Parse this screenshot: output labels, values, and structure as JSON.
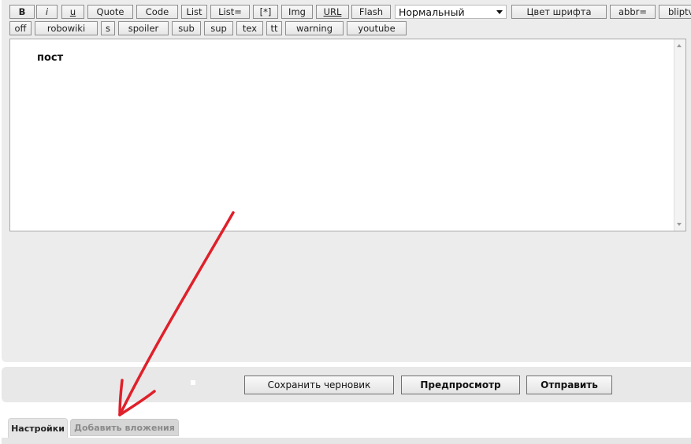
{
  "toolbar": {
    "row1": [
      {
        "label": "B"
      },
      {
        "label": "i"
      },
      {
        "label": "u"
      },
      {
        "label": "Quote"
      },
      {
        "label": "Code"
      },
      {
        "label": "List"
      },
      {
        "label": "List="
      },
      {
        "label": "[*]"
      },
      {
        "label": "Img"
      },
      {
        "label": "URL"
      },
      {
        "label": "Flash"
      }
    ],
    "font_size_select": "Нормальный",
    "row1_after": [
      {
        "label": "Цвет шрифта"
      },
      {
        "label": "abbr="
      },
      {
        "label": "bliptv"
      }
    ],
    "row2": [
      {
        "label": "off"
      },
      {
        "label": "robowiki"
      },
      {
        "label": "s"
      },
      {
        "label": "spoiler"
      },
      {
        "label": "sub"
      },
      {
        "label": "sup"
      },
      {
        "label": "tex"
      },
      {
        "label": "tt"
      },
      {
        "label": "warning"
      },
      {
        "label": "youtube"
      }
    ]
  },
  "editor": {
    "content": "пост"
  },
  "actions": {
    "save_draft": "Сохранить черновик",
    "preview": "Предпросмотр",
    "submit": "Отправить"
  },
  "tabs": [
    {
      "label": "Настройки",
      "active": true
    },
    {
      "label": "Добавить вложения",
      "active": false
    }
  ],
  "colors": {
    "panel": "#ececec",
    "annotation_arrow": "#e0202a"
  }
}
